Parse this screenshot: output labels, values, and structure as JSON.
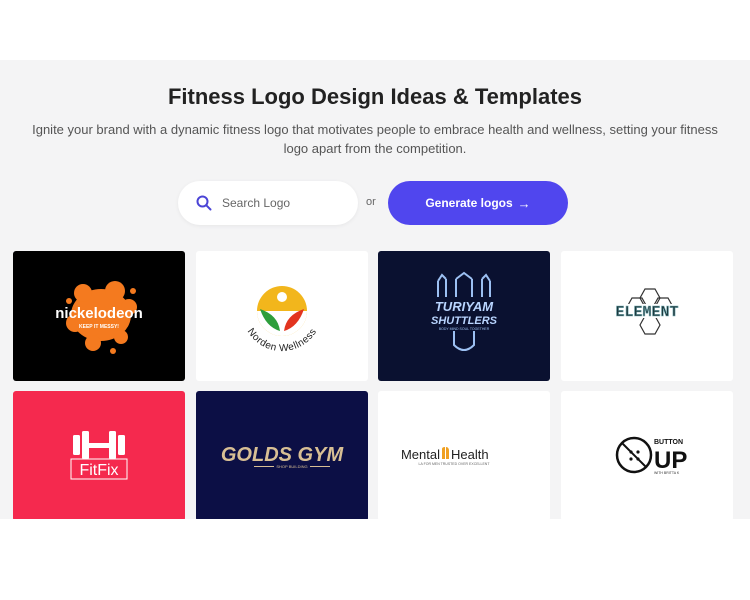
{
  "page": {
    "title": "Fitness Logo Design Ideas & Templates",
    "subtitle": "Ignite your brand with a dynamic fitness logo that motivates people to embrace health and wellness, setting your fitness logo apart from the competition."
  },
  "search": {
    "placeholder": "Search Logo",
    "icon": "search-icon"
  },
  "or_label": "or",
  "generate_button": {
    "label": "Generate logos",
    "icon": "arrow-right-icon"
  },
  "colors": {
    "accent": "#5046ee",
    "section_bg": "#f4f4f5"
  },
  "logos": [
    {
      "name": "nickelodeon",
      "text": "nickelodeon",
      "tagline": "KEEP IT MESSY!",
      "bg": "#000000"
    },
    {
      "name": "norden-wellness",
      "text": "Norden Wellness",
      "bg": "#ffffff"
    },
    {
      "name": "turiyam-shuttlers",
      "text": "TURIYAM",
      "text2": "SHUTTLERS",
      "tagline": "BODY MIND SOUL TOGETHER",
      "bg": "#0a1130"
    },
    {
      "name": "element",
      "text": "ELEMENT",
      "bg": "#ffffff"
    },
    {
      "name": "fitfix",
      "text": "FitFix",
      "bg": "#f5294e"
    },
    {
      "name": "golds-gym",
      "text": "GOLDS GYM",
      "tagline": "SHOP BUILDING",
      "bg": "#0c0f45"
    },
    {
      "name": "mental-health",
      "text": "Mental",
      "text2": "Health",
      "tagline": "LA FOR MEN TRUSTED OVER EXCELLENT",
      "bg": "#ffffff"
    },
    {
      "name": "button-up",
      "text": "BUTTON",
      "text2": "UP",
      "tagline": "WITH BRITTA K",
      "bg": "#ffffff"
    }
  ]
}
